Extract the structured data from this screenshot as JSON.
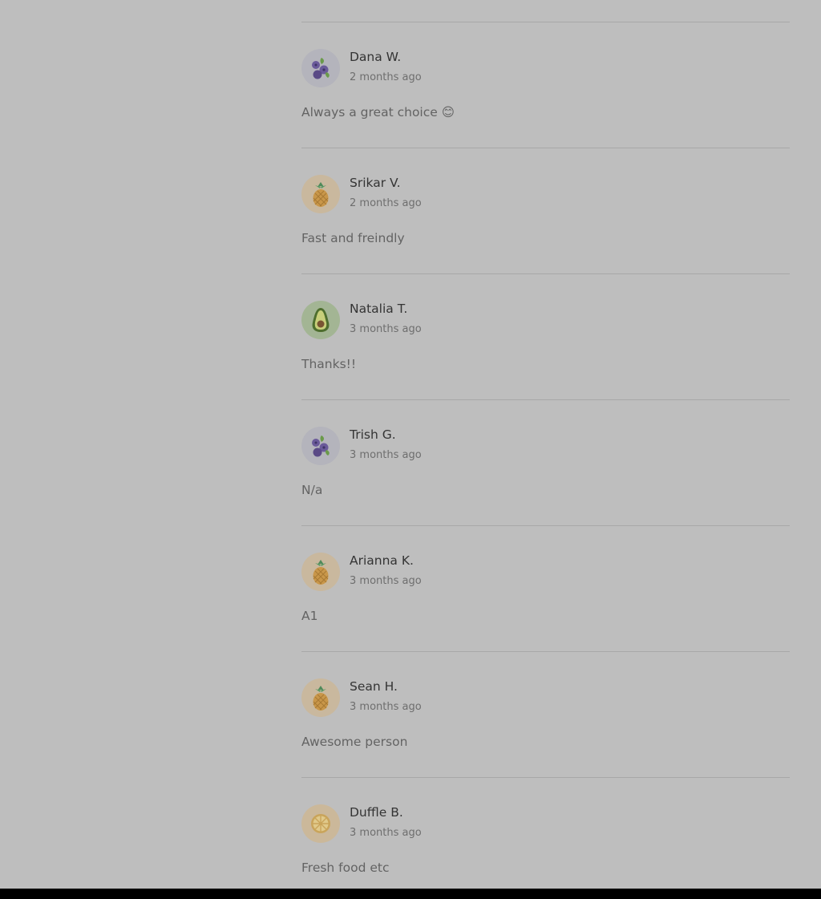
{
  "reviews": [
    {
      "name": "Dana W.",
      "time": "2 months ago",
      "text": "Always a great choice 😊",
      "avatar": "blueberries-icon",
      "avatar_bg": "#b4b4bc"
    },
    {
      "name": "Srikar V.",
      "time": "2 months ago",
      "text": "Fast and freindly",
      "avatar": "pineapple-icon",
      "avatar_bg": "#c9b89e"
    },
    {
      "name": "Natalia T.",
      "time": "3 months ago",
      "text": "Thanks!!",
      "avatar": "avocado-icon",
      "avatar_bg": "#a3b594"
    },
    {
      "name": "Trish G.",
      "time": "3 months ago",
      "text": "N/a",
      "avatar": "blueberries-icon",
      "avatar_bg": "#b4b4bc"
    },
    {
      "name": "Arianna K.",
      "time": "3 months ago",
      "text": "A1",
      "avatar": "pineapple-icon",
      "avatar_bg": "#c9b89e"
    },
    {
      "name": "Sean H.",
      "time": "3 months ago",
      "text": "Awesome person",
      "avatar": "pineapple-icon",
      "avatar_bg": "#c9b89e"
    },
    {
      "name": "Duffle B.",
      "time": "3 months ago",
      "text": "Fresh food etc",
      "avatar": "citrus-slice-icon",
      "avatar_bg": "#cbb89a"
    }
  ]
}
